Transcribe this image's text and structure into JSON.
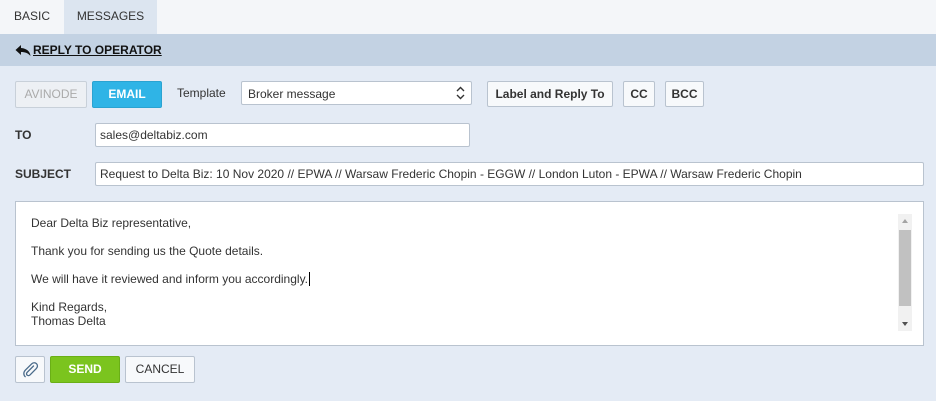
{
  "tabs": [
    {
      "label": "BASIC"
    },
    {
      "label": "MESSAGES"
    }
  ],
  "reply_bar": {
    "link_label": "REPLY TO OPERATOR",
    "icon": "reply-arrow-icon"
  },
  "toolbar": {
    "avinode_label": "AVINODE",
    "email_label": "EMAIL",
    "template_label": "Template",
    "template_value": "Broker message",
    "label_reply_label": "Label and Reply To",
    "cc_label": "CC",
    "bcc_label": "BCC"
  },
  "form": {
    "to_label": "TO",
    "to_value": "sales@deltabiz.com",
    "subject_label": "SUBJECT",
    "subject_value": "Request to Delta Biz: 10 Nov 2020 // EPWA // Warsaw Frederic Chopin - EGGW // London Luton - EPWA // Warsaw Frederic Chopin"
  },
  "message": {
    "lines": [
      "Dear Delta Biz representative,",
      "Thank you for sending us the Quote details.",
      "We will have it reviewed and inform you accordingly.",
      "Kind Regards,",
      "Thomas Delta"
    ]
  },
  "actions": {
    "attach_icon": "paperclip-icon",
    "send_label": "SEND",
    "cancel_label": "CANCEL"
  },
  "colors": {
    "email_button": "#2fb4e6",
    "send_button": "#7bc41e",
    "reply_bar": "#c3d2e3",
    "background": "#e4ebf5"
  }
}
